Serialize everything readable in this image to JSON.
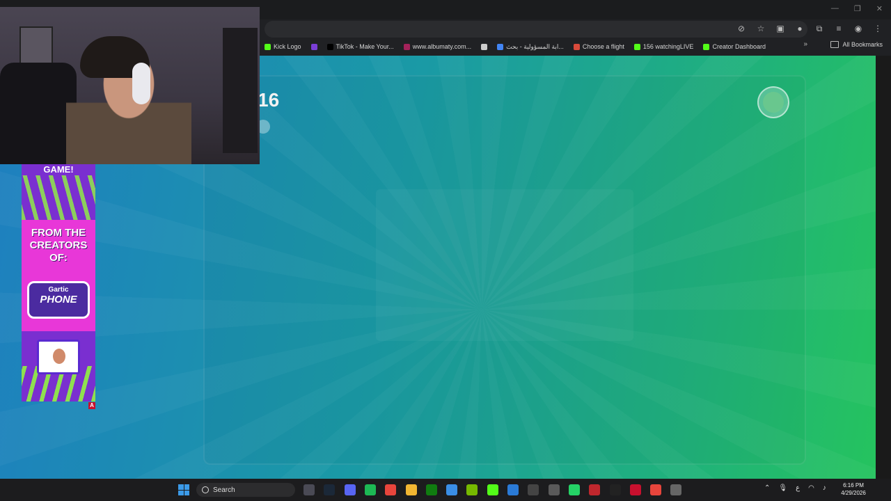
{
  "browser": {
    "bookmarks": [
      {
        "label": "Kick Logo",
        "color": "#53fc18"
      },
      {
        "label": "",
        "color": "#7a3ed6"
      },
      {
        "label": "TikTok - Make Your...",
        "color": "#000000"
      },
      {
        "label": "www.albumaty.com...",
        "color": "#a3225a"
      },
      {
        "label": "",
        "color": "#cccccc"
      },
      {
        "label": "ﺍﺑﺔ ﺍﻟﻤﺴﺆﻭﻟﻴﺔ - ﺑﺤﺚ...",
        "color": "#4285f4"
      },
      {
        "label": "Choose a flight",
        "color": "#d94a3b"
      },
      {
        "label": "156 watchingLIVE",
        "color": "#53fc18"
      },
      {
        "label": "Creator Dashboard",
        "color": "#53fc18"
      }
    ],
    "more_bookmarks": "»",
    "all_bookmarks": "All Bookmarks"
  },
  "game": {
    "counter": "16"
  },
  "ad": {
    "top_text": "GAME!",
    "tagline": "FROM THE CREATORS OF:",
    "logo_line1": "Gartic",
    "logo_line2": "PHONE",
    "choice_badge": "A"
  },
  "taskbar": {
    "search_label": "Search",
    "apps": [
      {
        "name": "camera",
        "color": "#4a4a55"
      },
      {
        "name": "steam",
        "color": "#1b2838"
      },
      {
        "name": "discord",
        "color": "#5865f2"
      },
      {
        "name": "spotify",
        "color": "#1db954"
      },
      {
        "name": "chrome",
        "color": "#e8453c"
      },
      {
        "name": "file-explorer",
        "color": "#f2b632"
      },
      {
        "name": "xbox",
        "color": "#107c10"
      },
      {
        "name": "store",
        "color": "#3a8ee6"
      },
      {
        "name": "nvidia",
        "color": "#76b900"
      },
      {
        "name": "kick",
        "color": "#53fc18"
      },
      {
        "name": "app",
        "color": "#2a7ad6"
      },
      {
        "name": "capcut",
        "color": "#444444"
      },
      {
        "name": "notepad",
        "color": "#5a5a5a"
      },
      {
        "name": "whatsapp",
        "color": "#25d366"
      },
      {
        "name": "wps",
        "color": "#c0272d"
      },
      {
        "name": "capcut-2",
        "color": "#222222"
      },
      {
        "name": "acrobat",
        "color": "#c8102e"
      },
      {
        "name": "chrome-2",
        "color": "#e8453c"
      },
      {
        "name": "settings",
        "color": "#666666"
      }
    ],
    "tray_lang": "ع",
    "time": "6:16 PM",
    "date": "4/29/2026"
  }
}
